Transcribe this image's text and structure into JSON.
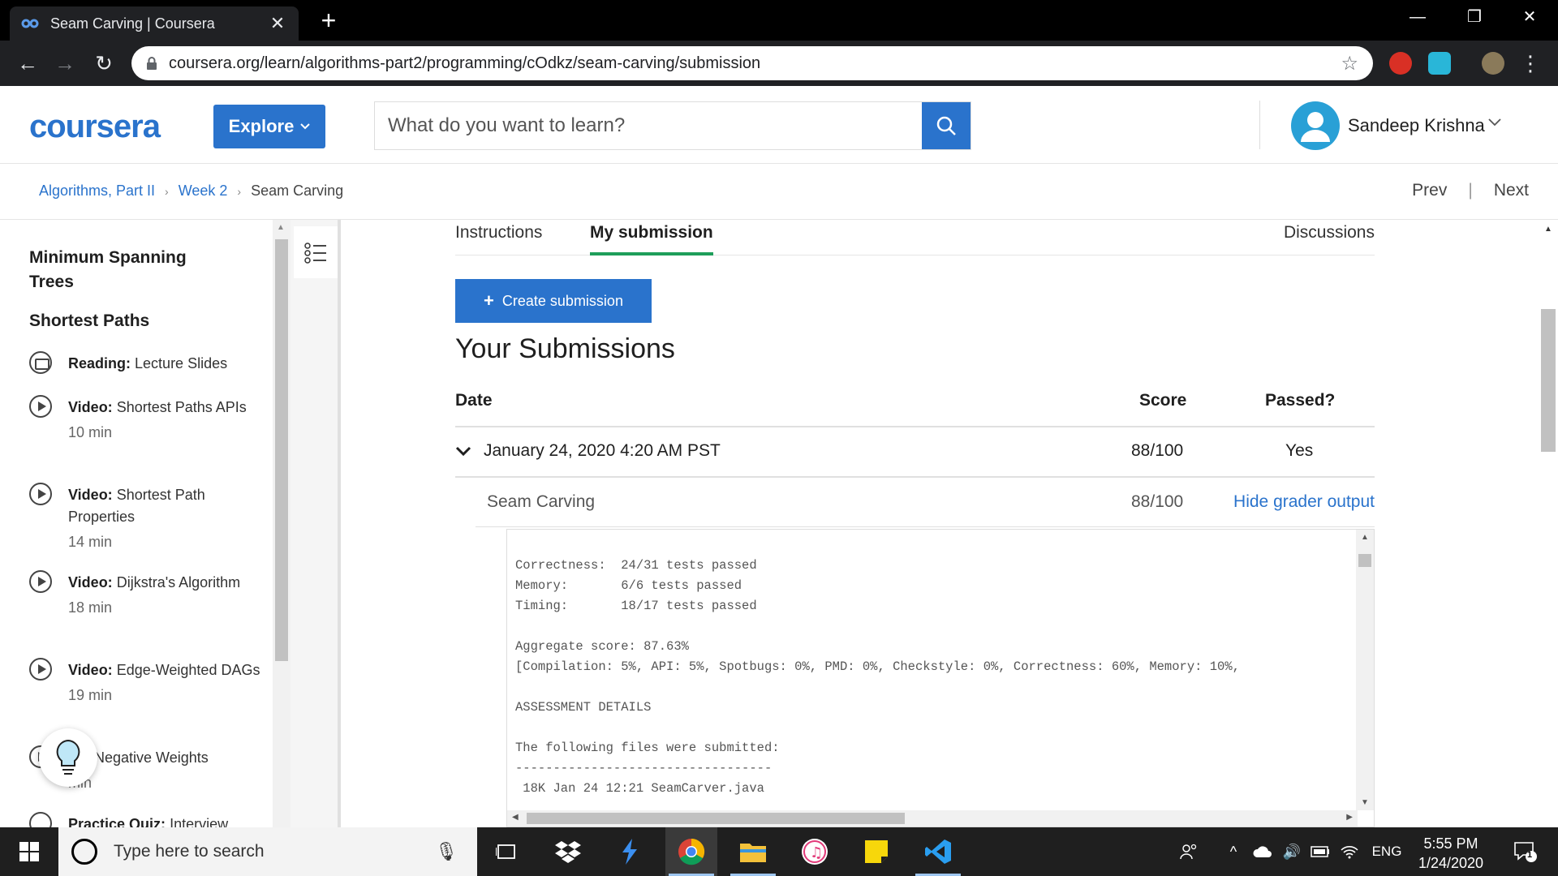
{
  "browser": {
    "tab_title": "Seam Carving | Coursera",
    "new_tab": "+",
    "url": "coursera.org/learn/algorithms-part2/programming/cOdkz/seam-carving/submission",
    "window_controls": [
      "minimize-icon",
      "restore-icon",
      "close-icon"
    ]
  },
  "header": {
    "logo": "coursera",
    "explore_label": "Explore",
    "search_placeholder": "What do you want to learn?",
    "user_name": "Sandeep Krishna",
    "brand_color": "#2a73cc"
  },
  "breadcrumb": {
    "items": [
      "Algorithms, Part II",
      "Week 2",
      "Seam Carving"
    ],
    "prev": "Prev",
    "separator": "|",
    "next": "Next"
  },
  "sidebar": {
    "sections": [
      "Minimum Spanning Trees",
      "Shortest Paths"
    ],
    "items": [
      {
        "type": "Reading:",
        "title": "Lecture Slides",
        "duration": "",
        "icon": "book-icon"
      },
      {
        "type": "Video:",
        "title": "Shortest Paths APIs",
        "duration": "10 min",
        "icon": "play-icon"
      },
      {
        "type": "Video:",
        "title": "Shortest Path Properties",
        "duration": "14 min",
        "icon": "play-icon"
      },
      {
        "type": "Video:",
        "title": "Dijkstra's Algorithm",
        "duration": "18 min",
        "icon": "play-icon"
      },
      {
        "type": "Video:",
        "title": "Edge-Weighted DAGs",
        "duration": "19 min",
        "icon": "play-icon"
      },
      {
        "type": "eo:",
        "title": "Negative Weights",
        "duration": "min",
        "icon": "play-icon"
      },
      {
        "type": "Practice Quiz:",
        "title": "Interview",
        "duration": "",
        "icon": "quiz-icon"
      }
    ]
  },
  "main": {
    "tabs": [
      "Instructions",
      "My submission",
      "Discussions"
    ],
    "active_tab": "My submission",
    "create_button": "Create submission",
    "title": "Your Submissions",
    "columns": [
      "Date",
      "Score",
      "Passed?"
    ],
    "submission": {
      "date": "January 24, 2020 4:20 AM PST",
      "score": "88/100",
      "passed": "Yes",
      "part_name": "Seam Carving",
      "part_score": "88/100",
      "toggle_label": "Hide grader output"
    },
    "grader_output": "Correctness:  24/31 tests passed\nMemory:       6/6 tests passed\nTiming:       18/17 tests passed\n\nAggregate score: 87.63%\n[Compilation: 5%, API: 5%, Spotbugs: 0%, PMD: 0%, Checkstyle: 0%, Correctness: 60%, Memory: 10%,\n\nASSESSMENT DETAILS\n\nThe following files were submitted:\n----------------------------------\n 18K Jan 24 12:21 SeamCarver.java",
    "accent_green": "#1e9e5a"
  },
  "taskbar": {
    "search_placeholder": "Type here to search",
    "tray_language": "ENG",
    "time": "5:55 PM",
    "date": "1/24/2020",
    "notification_count": "1",
    "apps": [
      "task-view-icon",
      "dropbox-icon",
      "bolt-app-icon",
      "chrome-icon",
      "file-explorer-icon",
      "itunes-icon",
      "sticky-notes-icon",
      "vscode-icon"
    ]
  }
}
